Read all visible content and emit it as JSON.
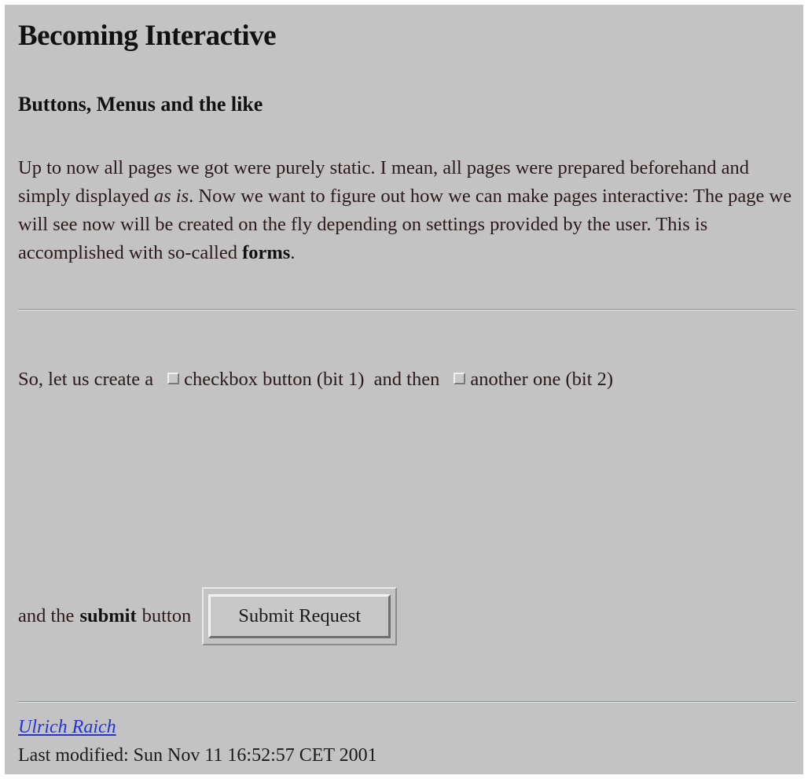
{
  "title": "Becoming Interactive",
  "subtitle": "Buttons, Menus and the like",
  "intro": {
    "part1": "Up to now all pages we got were purely static. I mean, all pages were prepared beforehand and simply displayed ",
    "em": "as is",
    "part2": ". Now we want to figure out how we can make pages interactive: The page we will see now will be created on the fly depending on settings provided by the user. This is accomplished with so-called ",
    "strong": "forms",
    "part3": "."
  },
  "checkbox_line": {
    "lead": "So, let us create a",
    "checkbox1_label": "checkbox button (bit 1)",
    "middle": "and then",
    "checkbox2_label": "another one (bit 2)",
    "checkbox1_checked": false,
    "checkbox2_checked": false
  },
  "submit_line": {
    "lead": "and the",
    "strong": "submit",
    "trail": "button",
    "button_label": "Submit Request"
  },
  "footer": {
    "author": "Ulrich Raich",
    "last_modified": "Last modified: Sun Nov 11 16:52:57 CET 2001"
  },
  "colors": {
    "background": "#c3c3c3",
    "link": "#2233dd",
    "text": "#2a1a1a"
  }
}
